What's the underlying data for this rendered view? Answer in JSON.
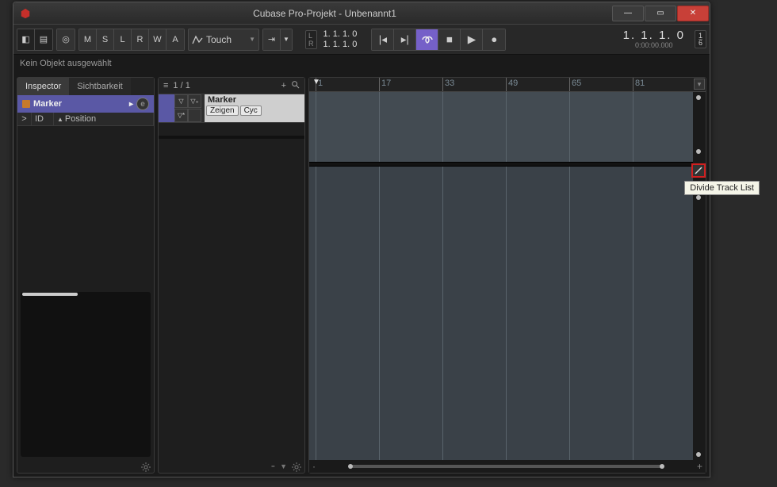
{
  "window": {
    "title": "Cubase Pro-Projekt - Unbenannt1"
  },
  "toolbar": {
    "automation": [
      "M",
      "S",
      "L",
      "R",
      "W",
      "A"
    ],
    "touch_label": "Touch",
    "lr_left": "L",
    "lr_right": "R",
    "time_top": "1.  1.  1.    0",
    "time_bottom": "1.  1.  1.    0",
    "main_time": "1.  1.  1.    0",
    "sub_time": "0:00:00.000",
    "frac_top": "1",
    "frac_bot": "6"
  },
  "status": {
    "text": "Kein Objekt ausgewählt"
  },
  "inspector": {
    "tabs": {
      "inspector": "Inspector",
      "visibility": "Sichtbarkeit"
    },
    "track_name": "Marker",
    "sub_id": "ID",
    "sub_pos": "Position"
  },
  "tracklist": {
    "count": "1 / 1",
    "marker_name": "Marker",
    "btn_show": "Zeigen",
    "btn_cycle": "Cyc"
  },
  "ruler": {
    "ticks": [
      "1",
      "17",
      "33",
      "49",
      "65",
      "81"
    ]
  },
  "tooltip": {
    "divide": "Divide Track List"
  }
}
